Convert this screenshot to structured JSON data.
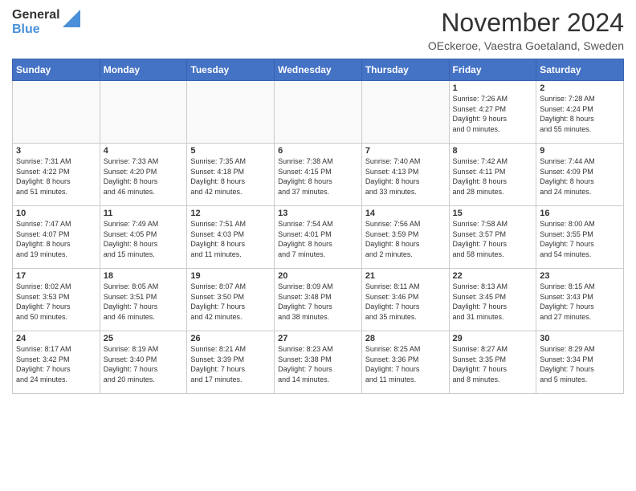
{
  "header": {
    "logo": {
      "general": "General",
      "blue": "Blue"
    },
    "title": "November 2024",
    "location": "OEckeroe, Vaestra Goetaland, Sweden"
  },
  "days_of_week": [
    "Sunday",
    "Monday",
    "Tuesday",
    "Wednesday",
    "Thursday",
    "Friday",
    "Saturday"
  ],
  "weeks": [
    [
      {
        "day": "",
        "info": ""
      },
      {
        "day": "",
        "info": ""
      },
      {
        "day": "",
        "info": ""
      },
      {
        "day": "",
        "info": ""
      },
      {
        "day": "",
        "info": ""
      },
      {
        "day": "1",
        "info": "Sunrise: 7:26 AM\nSunset: 4:27 PM\nDaylight: 9 hours\nand 0 minutes."
      },
      {
        "day": "2",
        "info": "Sunrise: 7:28 AM\nSunset: 4:24 PM\nDaylight: 8 hours\nand 55 minutes."
      }
    ],
    [
      {
        "day": "3",
        "info": "Sunrise: 7:31 AM\nSunset: 4:22 PM\nDaylight: 8 hours\nand 51 minutes."
      },
      {
        "day": "4",
        "info": "Sunrise: 7:33 AM\nSunset: 4:20 PM\nDaylight: 8 hours\nand 46 minutes."
      },
      {
        "day": "5",
        "info": "Sunrise: 7:35 AM\nSunset: 4:18 PM\nDaylight: 8 hours\nand 42 minutes."
      },
      {
        "day": "6",
        "info": "Sunrise: 7:38 AM\nSunset: 4:15 PM\nDaylight: 8 hours\nand 37 minutes."
      },
      {
        "day": "7",
        "info": "Sunrise: 7:40 AM\nSunset: 4:13 PM\nDaylight: 8 hours\nand 33 minutes."
      },
      {
        "day": "8",
        "info": "Sunrise: 7:42 AM\nSunset: 4:11 PM\nDaylight: 8 hours\nand 28 minutes."
      },
      {
        "day": "9",
        "info": "Sunrise: 7:44 AM\nSunset: 4:09 PM\nDaylight: 8 hours\nand 24 minutes."
      }
    ],
    [
      {
        "day": "10",
        "info": "Sunrise: 7:47 AM\nSunset: 4:07 PM\nDaylight: 8 hours\nand 19 minutes."
      },
      {
        "day": "11",
        "info": "Sunrise: 7:49 AM\nSunset: 4:05 PM\nDaylight: 8 hours\nand 15 minutes."
      },
      {
        "day": "12",
        "info": "Sunrise: 7:51 AM\nSunset: 4:03 PM\nDaylight: 8 hours\nand 11 minutes."
      },
      {
        "day": "13",
        "info": "Sunrise: 7:54 AM\nSunset: 4:01 PM\nDaylight: 8 hours\nand 7 minutes."
      },
      {
        "day": "14",
        "info": "Sunrise: 7:56 AM\nSunset: 3:59 PM\nDaylight: 8 hours\nand 2 minutes."
      },
      {
        "day": "15",
        "info": "Sunrise: 7:58 AM\nSunset: 3:57 PM\nDaylight: 7 hours\nand 58 minutes."
      },
      {
        "day": "16",
        "info": "Sunrise: 8:00 AM\nSunset: 3:55 PM\nDaylight: 7 hours\nand 54 minutes."
      }
    ],
    [
      {
        "day": "17",
        "info": "Sunrise: 8:02 AM\nSunset: 3:53 PM\nDaylight: 7 hours\nand 50 minutes."
      },
      {
        "day": "18",
        "info": "Sunrise: 8:05 AM\nSunset: 3:51 PM\nDaylight: 7 hours\nand 46 minutes."
      },
      {
        "day": "19",
        "info": "Sunrise: 8:07 AM\nSunset: 3:50 PM\nDaylight: 7 hours\nand 42 minutes."
      },
      {
        "day": "20",
        "info": "Sunrise: 8:09 AM\nSunset: 3:48 PM\nDaylight: 7 hours\nand 38 minutes."
      },
      {
        "day": "21",
        "info": "Sunrise: 8:11 AM\nSunset: 3:46 PM\nDaylight: 7 hours\nand 35 minutes."
      },
      {
        "day": "22",
        "info": "Sunrise: 8:13 AM\nSunset: 3:45 PM\nDaylight: 7 hours\nand 31 minutes."
      },
      {
        "day": "23",
        "info": "Sunrise: 8:15 AM\nSunset: 3:43 PM\nDaylight: 7 hours\nand 27 minutes."
      }
    ],
    [
      {
        "day": "24",
        "info": "Sunrise: 8:17 AM\nSunset: 3:42 PM\nDaylight: 7 hours\nand 24 minutes."
      },
      {
        "day": "25",
        "info": "Sunrise: 8:19 AM\nSunset: 3:40 PM\nDaylight: 7 hours\nand 20 minutes."
      },
      {
        "day": "26",
        "info": "Sunrise: 8:21 AM\nSunset: 3:39 PM\nDaylight: 7 hours\nand 17 minutes."
      },
      {
        "day": "27",
        "info": "Sunrise: 8:23 AM\nSunset: 3:38 PM\nDaylight: 7 hours\nand 14 minutes."
      },
      {
        "day": "28",
        "info": "Sunrise: 8:25 AM\nSunset: 3:36 PM\nDaylight: 7 hours\nand 11 minutes."
      },
      {
        "day": "29",
        "info": "Sunrise: 8:27 AM\nSunset: 3:35 PM\nDaylight: 7 hours\nand 8 minutes."
      },
      {
        "day": "30",
        "info": "Sunrise: 8:29 AM\nSunset: 3:34 PM\nDaylight: 7 hours\nand 5 minutes."
      }
    ]
  ]
}
